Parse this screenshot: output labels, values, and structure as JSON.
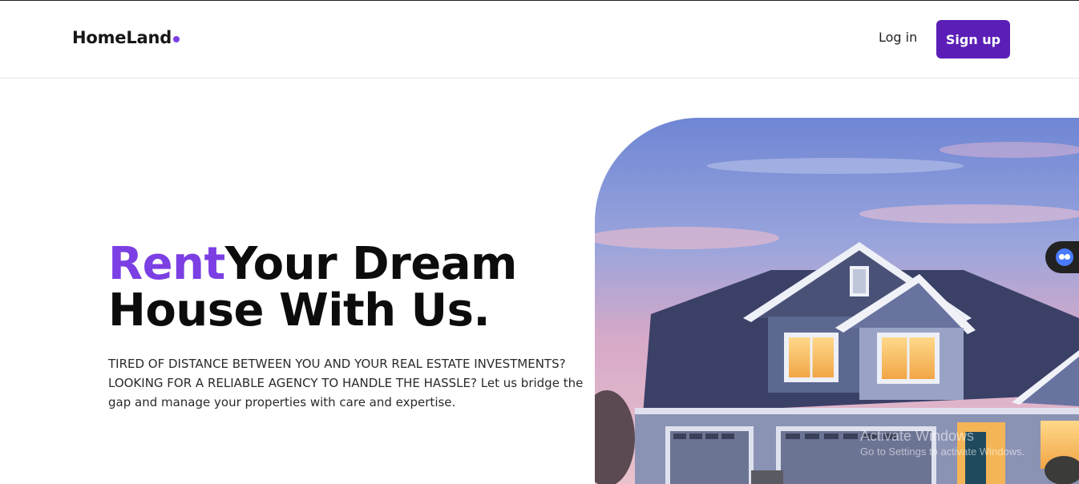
{
  "brand": {
    "name": "HomeLand",
    "accent": "#7b3fe4"
  },
  "nav": {
    "login_label": "Log in",
    "signup_label": "Sign up",
    "signup_color": "#5b1fb8"
  },
  "hero": {
    "title_accent": "Rent",
    "title_rest_line1": "Your Dream",
    "title_line2": "House With Us.",
    "description": "TIRED OF DISTANCE BETWEEN YOU AND YOUR REAL ESTATE INVESTMENTS? LOOKING FOR A RELIABLE AGENCY TO HANDLE THE HASSLE? Let us bridge the gap and manage your properties with care and expertise.",
    "image": "house-photo"
  },
  "floating_widget": {
    "icon": "assistant-icon"
  },
  "watermark": {
    "title": "Activate Windows",
    "subtitle": "Go to Settings to activate Windows."
  }
}
